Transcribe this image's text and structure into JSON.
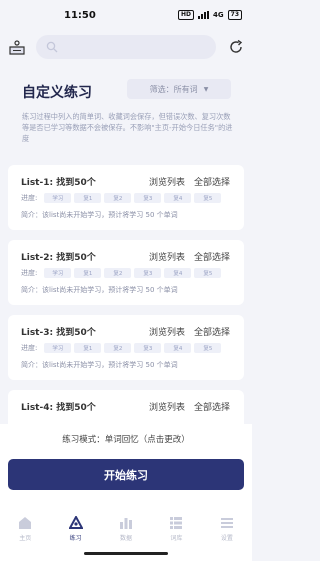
{
  "status": {
    "time": "11:50",
    "signal": "HD",
    "network": "4G",
    "battery": "73"
  },
  "search": {
    "placeholder": ""
  },
  "header": {
    "title": "自定义练习",
    "filter_label": "筛选：所有词",
    "filter_caret": "▼"
  },
  "description": "练习过程中列入的简单词、收藏词会保存，但错误次数、复习次数等是否已学习等数据不会被保存。不影响\"主页-开始今日任务\"的进度",
  "list_actions": {
    "browse": "浏览列表",
    "select_all": "全部选择"
  },
  "progress_label": "进度:",
  "chips": [
    "学习",
    "复1",
    "复2",
    "复3",
    "复4",
    "复5"
  ],
  "lists": [
    {
      "title": "List-1:  找到50个",
      "summary": "简介：该list尚未开始学习，预计将学习 50 个单词"
    },
    {
      "title": "List-2:  找到50个",
      "summary": "简介：该list尚未开始学习，预计将学习 50 个单词"
    },
    {
      "title": "List-3:  找到50个",
      "summary": "简介：该list尚未开始学习，预计将学习 50 个单词"
    },
    {
      "title": "List-4:  找到50个",
      "summary": ""
    }
  ],
  "practice_mode": "练习模式：单词回忆（点击更改）",
  "start_button": "开始练习",
  "tabs": [
    {
      "label": "主页",
      "icon": "home-icon",
      "active": false
    },
    {
      "label": "练习",
      "icon": "practice-icon",
      "active": true
    },
    {
      "label": "数据",
      "icon": "chart-icon",
      "active": false
    },
    {
      "label": "词库",
      "icon": "list-icon",
      "active": false
    },
    {
      "label": "设置",
      "icon": "menu-icon",
      "active": false
    }
  ]
}
